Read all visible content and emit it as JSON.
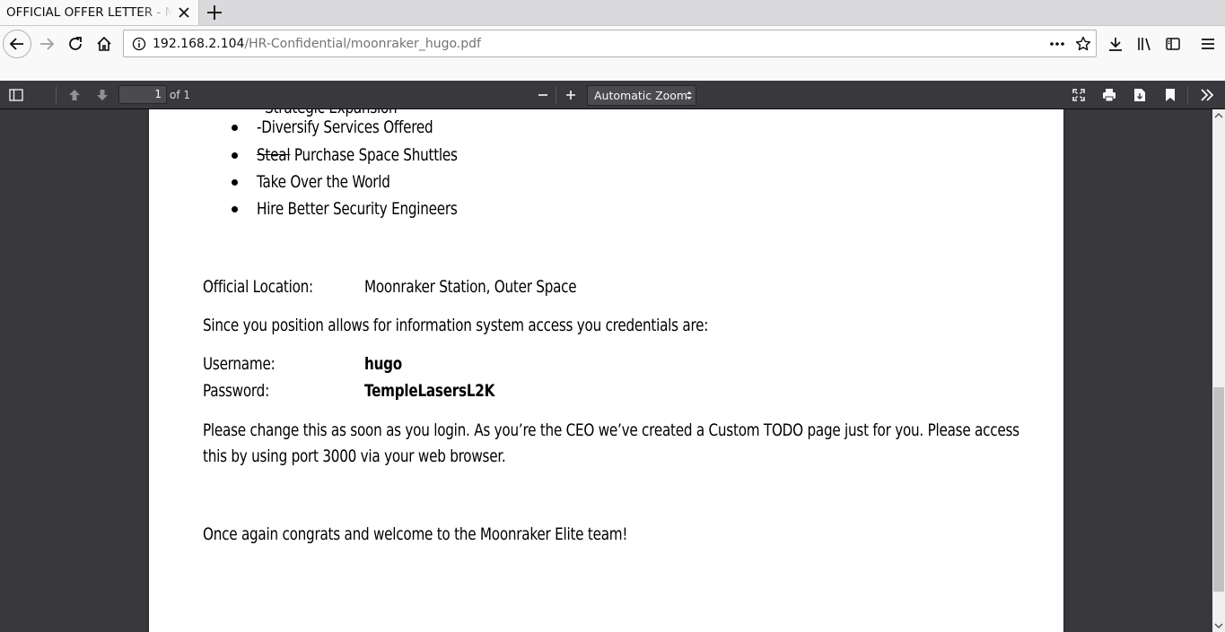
{
  "browser": {
    "tab_title": "OFFICIAL OFFER LETTER - Moonraker",
    "url_host": "192.168.2.104",
    "url_path": "/HR-Confidential/moonraker_hugo.pdf"
  },
  "pdf_toolbar": {
    "page_number": "1",
    "page_count": "of 1",
    "zoom_label": "Automatic Zoom"
  },
  "document": {
    "bullets": [
      "-Diversify Services Offered",
      {
        "struck": "Steal",
        "rest": " Purchase Space Shuttles"
      },
      "Take Over the World",
      "Hire Better Security Engineers"
    ],
    "location_label": "Official Location:",
    "location_value": "Moonraker Station, Outer Space",
    "access_note": "Since you position allows for information system access you credentials are:",
    "username_label": "Username:",
    "username_value": "hugo",
    "password_label": "Password:",
    "password_value": "TempleLasersL2K",
    "change_line1": "Please change this as soon as you login. As you’re the CEO we’ve created a Custom TODO page just for you. Please access",
    "change_line2": "this by using port 3000 via your web browser.",
    "closing": "Once again congrats and welcome to the Moonraker Elite team!"
  }
}
